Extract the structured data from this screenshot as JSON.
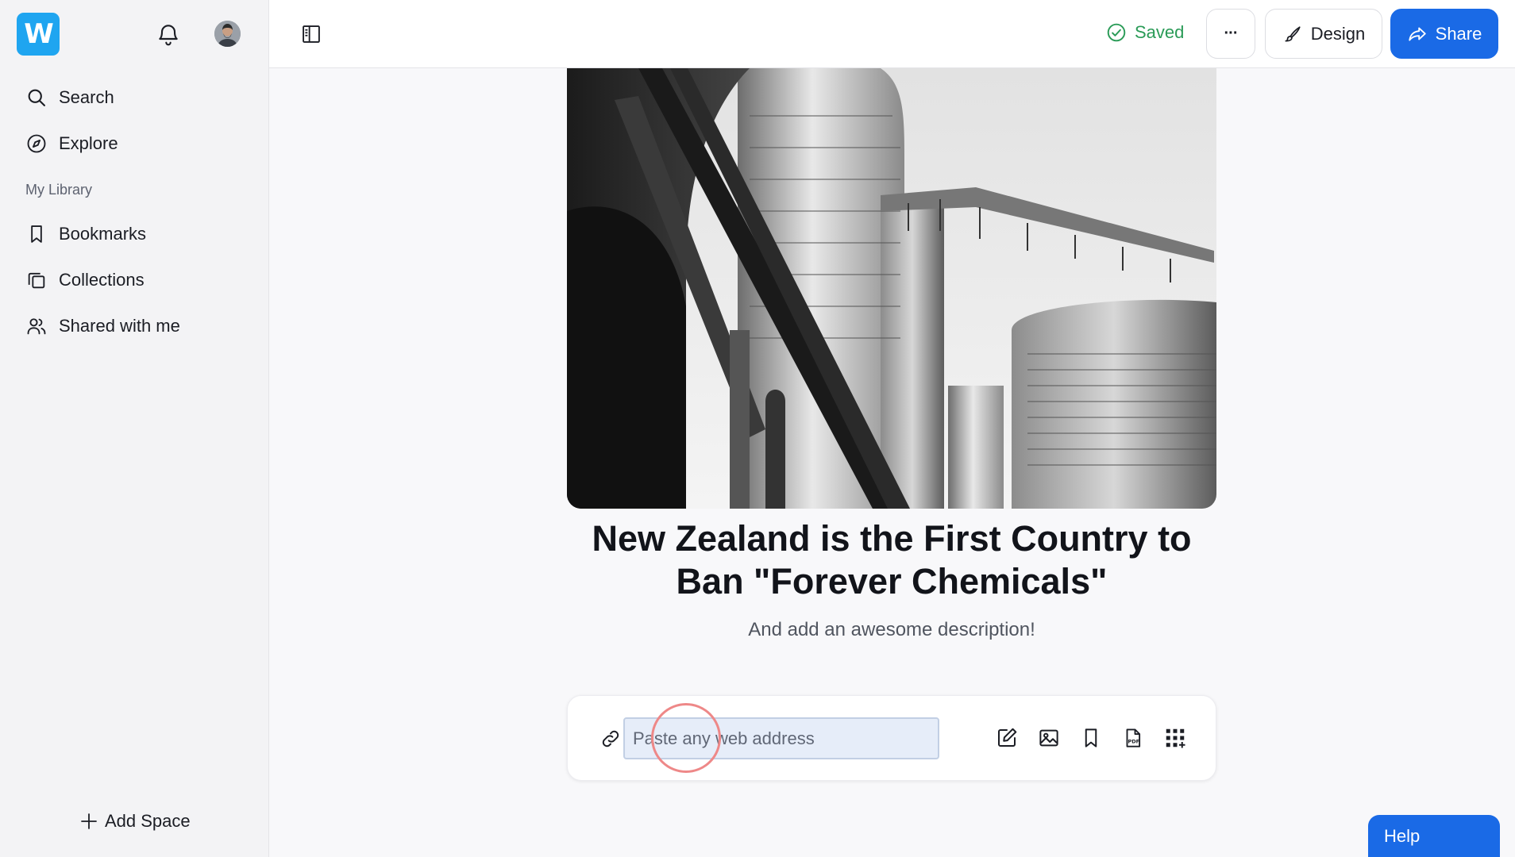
{
  "app": {
    "logo_letter": "W"
  },
  "sidebar": {
    "nav": [
      {
        "label": "Search",
        "icon": "search-icon"
      },
      {
        "label": "Explore",
        "icon": "compass-icon"
      }
    ],
    "section_label": "My Library",
    "library": [
      {
        "label": "Bookmarks",
        "icon": "bookmark-icon"
      },
      {
        "label": "Collections",
        "icon": "collections-icon"
      },
      {
        "label": "Shared with me",
        "icon": "users-icon"
      }
    ],
    "add_space_label": "Add Space"
  },
  "topbar": {
    "status_label": "Saved",
    "more_label": "···",
    "design_label": "Design",
    "share_label": "Share"
  },
  "content": {
    "title": "New Zealand is the First Country to Ban \"Forever Chemicals\"",
    "description": "And add an awesome description!",
    "url_placeholder": "Paste any web address"
  },
  "help_label": "Help",
  "colors": {
    "accent": "#1a6ae6",
    "logo": "#1fa5f0",
    "saved": "#2a9b57"
  }
}
